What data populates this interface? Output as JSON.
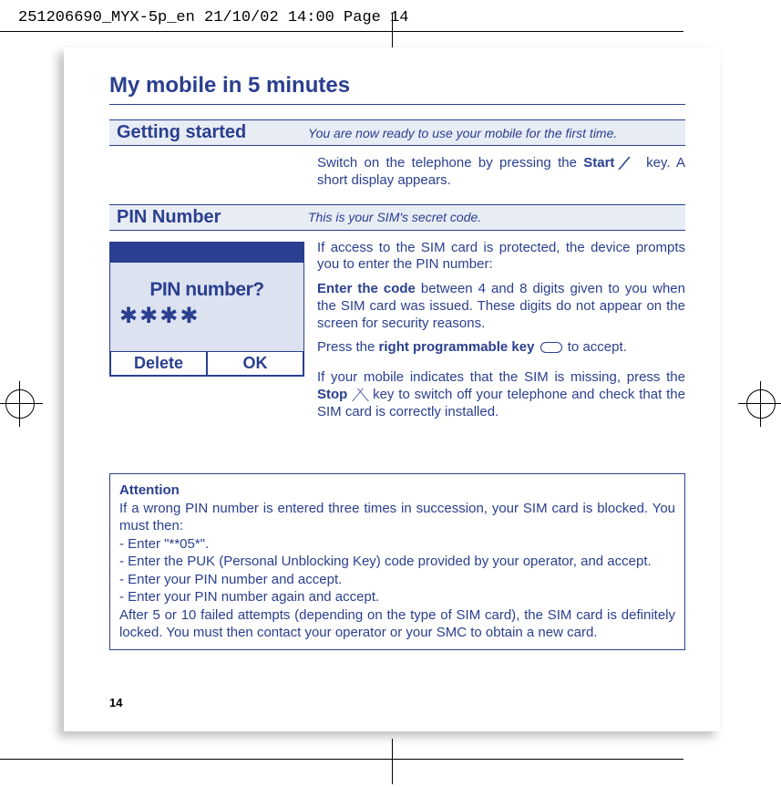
{
  "crop_header": "251206690_MYX-5p_en  21/10/02  14:00  Page 14",
  "title": "My mobile in 5 minutes",
  "section1": {
    "heading": "Getting started",
    "tagline": "You are now ready to use your mobile for the first time.",
    "para1a": "Switch on the telephone by pressing the ",
    "para1b": "Start",
    "para1c": " key. A short display appears."
  },
  "section2": {
    "heading": "PIN Number",
    "tagline": "This is your SIM's secret code."
  },
  "phone": {
    "title": "PIN number?",
    "stars": "✱✱✱✱",
    "left": "Delete",
    "right": "OK"
  },
  "pin": {
    "p1": "If access to the SIM card is protected, the device prompts you to enter the PIN number:",
    "p2a": "Enter the code",
    "p2b": " between 4 and 8 digits given to you when the SIM card was issued. These digits do not appear on the screen for security reasons.",
    "p3a": "Press the ",
    "p3b": "right programmable key",
    "p3c": " to accept.",
    "p4a": "If your mobile indicates that the SIM is missing, press the ",
    "p4b": "Stop",
    "p4c": " key to switch off your telephone and check that the SIM card is correctly installed."
  },
  "attention": {
    "head": "Attention",
    "l1": "If a wrong PIN number is entered three times in succession, your SIM card is blocked. You must then:",
    "l2": "- Enter \"**05*\".",
    "l3": "- Enter the PUK (Personal Unblocking Key) code provided by your operator, and accept.",
    "l4": "- Enter your PIN number and accept.",
    "l5": "- Enter your PIN number again and accept.",
    "l6": "After 5 or 10 failed attempts (depending on the type of SIM card), the SIM card is definitely locked. You must then contact your operator or your SMC to obtain a new card."
  },
  "page_number": "14"
}
